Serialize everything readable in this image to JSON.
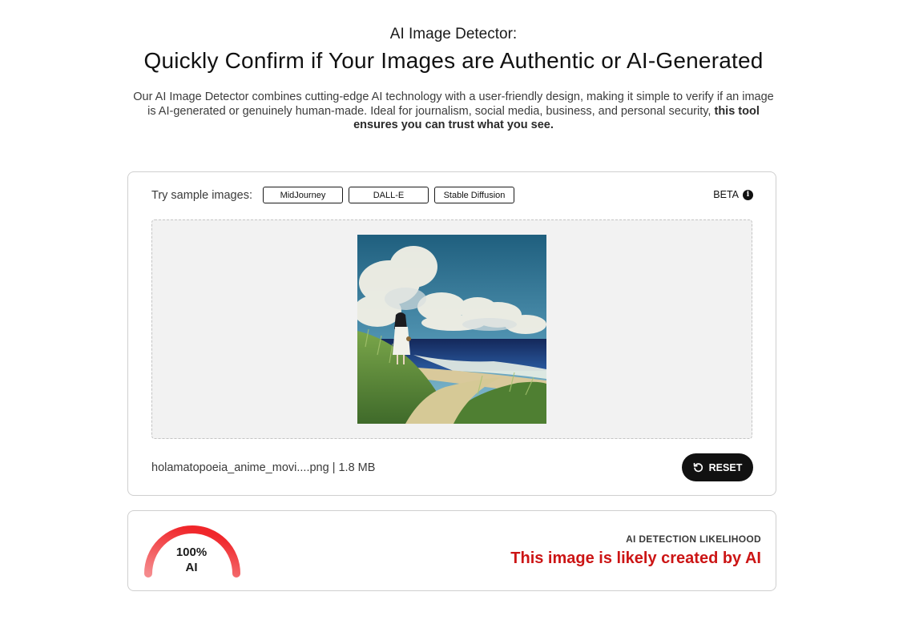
{
  "header": {
    "eyebrow": "AI Image Detector:",
    "title": "Quickly Confirm if Your Images are Authentic or AI-Generated",
    "intro_text": "Our AI Image Detector combines cutting-edge AI technology with a user-friendly design, making it simple to verify if an image is AI-generated or genuinely human-made. Ideal for journalism, social media, business, and personal security, ",
    "intro_bold": "this tool ensures you can trust what you see."
  },
  "samples": {
    "label": "Try sample images:",
    "buttons": [
      "MidJourney",
      "DALL-E",
      "Stable Diffusion"
    ]
  },
  "beta": {
    "label": "BETA",
    "icon": "info-icon"
  },
  "upload": {
    "file_info": "holamatopoeia_anime_movi....png | 1.8 MB",
    "reset_label": "RESET",
    "reset_icon": "reset-icon"
  },
  "result": {
    "gauge_percent": 100,
    "gauge_value": "100%",
    "gauge_unit": "AI",
    "label": "AI DETECTION LIKELIHOOD",
    "verdict": "This image is likely created by AI",
    "verdict_color": "#cc1515",
    "gauge_color": "#f0262a"
  }
}
